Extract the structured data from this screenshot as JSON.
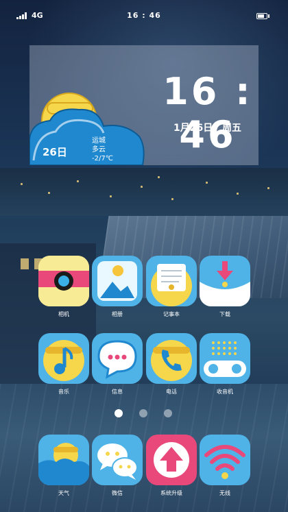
{
  "status_bar": {
    "network": "4G",
    "time": "16 : 46"
  },
  "weather_widget": {
    "time": "16 : 46",
    "date": "1月26日",
    "weekday": "周五",
    "day": "26日",
    "city": "运城",
    "condition": "多云",
    "temperature": "-2/7℃"
  },
  "apps": [
    {
      "label": "相机",
      "icon": "camera-icon"
    },
    {
      "label": "相册",
      "icon": "gallery-icon"
    },
    {
      "label": "记事本",
      "icon": "notepad-icon"
    },
    {
      "label": "下载",
      "icon": "download-icon"
    },
    {
      "label": "音乐",
      "icon": "music-icon"
    },
    {
      "label": "信息",
      "icon": "messages-icon"
    },
    {
      "label": "电话",
      "icon": "phone-icon"
    },
    {
      "label": "收音机",
      "icon": "radio-icon"
    }
  ],
  "dock": [
    {
      "label": "天气",
      "icon": "weather-icon"
    },
    {
      "label": "微信",
      "icon": "wechat-icon"
    },
    {
      "label": "系统升级",
      "icon": "system-update-icon"
    },
    {
      "label": "无线",
      "icon": "wifi-icon"
    }
  ],
  "page_indicator": {
    "pages": 3,
    "current": 1
  },
  "colors": {
    "tile_blue": "#4fb3e8",
    "bell_yellow": "#f6d64a",
    "accent_pink": "#e8497a",
    "cloud_blue": "#1f88cf"
  }
}
